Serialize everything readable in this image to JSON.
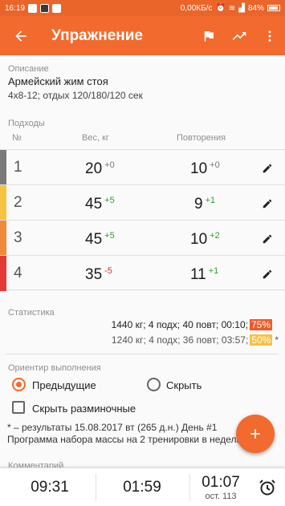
{
  "status_bar": {
    "time": "16:19",
    "net_speed": "0,00КБ/с",
    "battery": "84%"
  },
  "appbar": {
    "title": "Упражнение"
  },
  "description": {
    "label": "Описание",
    "title": "Армейский жим стоя",
    "text": "4x8-12; отдых 120/180/120 сек"
  },
  "sets": {
    "label": "Подходы",
    "headers": {
      "num": "№",
      "weight": "Вес, кг",
      "reps": "Повторения"
    },
    "rows": [
      {
        "num": "1",
        "weight": "20",
        "weight_delta": "+0",
        "reps": "10",
        "reps_delta": "+0",
        "color": "#7a7a7a"
      },
      {
        "num": "2",
        "weight": "45",
        "weight_delta": "+5",
        "reps": "9",
        "reps_delta": "+1",
        "color": "#f5c242"
      },
      {
        "num": "3",
        "weight": "45",
        "weight_delta": "+5",
        "reps": "10",
        "reps_delta": "+2",
        "color": "#f0893a"
      },
      {
        "num": "4",
        "weight": "35",
        "weight_delta": "-5",
        "reps": "11",
        "reps_delta": "+1",
        "color": "#e53935"
      }
    ]
  },
  "stats": {
    "label": "Статистика",
    "line1": "1440 кг; 4 подх; 40 повт; 00:10;",
    "line1_pct": "75%",
    "line2": "1240 кг; 4 подх; 36 повт; 03:57;",
    "line2_pct": "50%",
    "line2_mark": "*"
  },
  "guide": {
    "label": "Ориентир выполнения",
    "option_previous": "Предыдущие",
    "option_hide": "Скрыть",
    "selected": "Предыдущие",
    "checkbox_label": "Скрыть разминочные",
    "checkbox_checked": false
  },
  "footnote": {
    "line1": "* – результаты 15.08.2017 вт (265 д.н.) День #1",
    "line2": "Программа набора массы на 2 тренировки в неделю"
  },
  "comment": {
    "label": "Комментарий"
  },
  "timers": {
    "t1": "09:31",
    "t2": "01:59",
    "t3": "01:07",
    "t3_sub": "ост. 113"
  },
  "colors": {
    "accent": "#f26a2e",
    "positive": "#2e9e2e",
    "negative": "#d32f2f"
  },
  "icons": {
    "back": "arrow-left-icon",
    "flag": "flag-icon",
    "trend": "trending-up-icon",
    "more": "more-vertical-icon",
    "edit": "pencil-icon",
    "add": "plus-icon",
    "alarm": "alarm-clock-icon"
  }
}
